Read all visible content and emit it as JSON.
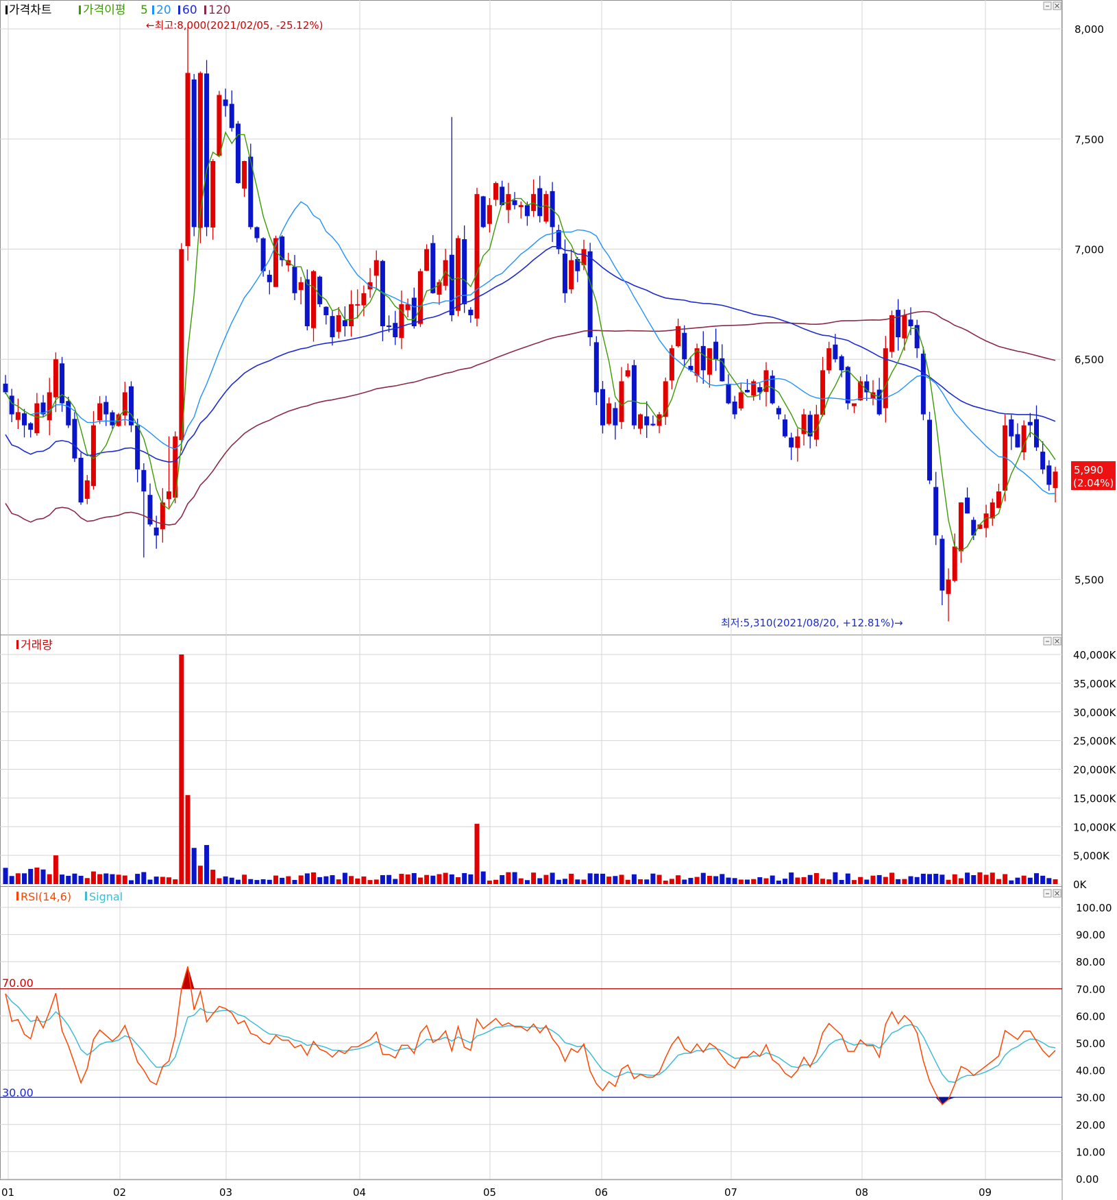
{
  "price_panel": {
    "legend": [
      {
        "text": "가격차트",
        "color": "#000000"
      },
      {
        "text": "가격이평",
        "color": "#3a9a00"
      },
      {
        "text": "5",
        "color": "#3a9a00"
      },
      {
        "text": "20",
        "color": "#1e90ff"
      },
      {
        "text": "60",
        "color": "#1c2bd0"
      },
      {
        "text": "120",
        "color": "#8b2a45"
      }
    ],
    "high_annotation": "←최고:8,000(2021/02/05, -25.12%)",
    "low_annotation": "최저:5,310(2021/08/20, +12.81%)→",
    "last_price": "5,990",
    "last_change": "(2.04%)",
    "y_ticks": [
      "8,000",
      "7,500",
      "7,000",
      "6,500",
      "6,000",
      "5,500"
    ]
  },
  "volume_panel": {
    "legend": "거래량",
    "y_ticks": [
      "40,000K",
      "35,000K",
      "30,000K",
      "25,000K",
      "20,000K",
      "15,000K",
      "10,000K",
      "5,000K",
      "0K"
    ]
  },
  "rsi_panel": {
    "legend_rsi": "RSI(14,6)",
    "legend_signal": "Signal",
    "overbought_label": "70.00",
    "oversold_label": "30.00",
    "y_ticks": [
      "100.00",
      "90.00",
      "80.00",
      "70.00",
      "60.00",
      "50.00",
      "40.00",
      "30.00",
      "20.00",
      "10.00",
      "0.00"
    ]
  },
  "x_ticks": [
    "01",
    "02",
    "03",
    "04",
    "05",
    "06",
    "07",
    "08",
    "09"
  ],
  "colors": {
    "up": "#e00000",
    "down": "#0a14c8",
    "ma5": "#3a9a00",
    "ma20": "#1e90ff",
    "ma60": "#1c2bd0",
    "ma120": "#8b2a45",
    "rsi": "#ff4500",
    "signal": "#3cbcd8",
    "grid": "#d4d4d4"
  },
  "chart_data": [
    {
      "type": "candlestick",
      "title": "가격차트",
      "x_months": [
        "01",
        "02",
        "03",
        "04",
        "05",
        "06",
        "07",
        "08",
        "09"
      ],
      "ylim": [
        5250,
        8100
      ],
      "high": {
        "value": 8000,
        "date": "2021/02/05"
      },
      "low": {
        "value": 5310,
        "date": "2021/08/20"
      },
      "last": 5990,
      "closes": [
        6350,
        6250,
        6260,
        6200,
        6180,
        6300,
        6250,
        6350,
        6500,
        6300,
        6200,
        6050,
        5850,
        5950,
        6200,
        6300,
        6250,
        6200,
        6250,
        6350,
        6200,
        6000,
        5900,
        5750,
        5700,
        5850,
        5900,
        6150,
        7000,
        7800,
        7100,
        7800,
        7100,
        7400,
        7700,
        7650,
        7550,
        7300,
        7400,
        7100,
        7050,
        6900,
        6850,
        7050,
        6950,
        6950,
        6800,
        6850,
        6650,
        6900,
        6750,
        6700,
        6600,
        6700,
        6650,
        6750,
        6750,
        6800,
        6850,
        6950,
        6650,
        6650,
        6600,
        6750,
        6750,
        6650,
        6900,
        7000,
        6800,
        6850,
        6950,
        6700,
        7050,
        6750,
        6700,
        7250,
        7100,
        7200,
        7300,
        7200,
        7250,
        7200,
        7200,
        7150,
        7250,
        7150,
        7250,
        7100,
        7000,
        6800,
        6950,
        6900,
        7000,
        6600,
        6350,
        6200,
        6300,
        6200,
        6400,
        6450,
        6200,
        6250,
        6200,
        6200,
        6250,
        6400,
        6550,
        6650,
        6500,
        6450,
        6550,
        6450,
        6550,
        6500,
        6400,
        6300,
        6250,
        6350,
        6350,
        6400,
        6350,
        6450,
        6300,
        6250,
        6150,
        6100,
        6150,
        6250,
        6150,
        6250,
        6450,
        6550,
        6500,
        6450,
        6300,
        6300,
        6400,
        6350,
        6350,
        6250,
        6550,
        6700,
        6600,
        6700,
        6650,
        6550,
        6250,
        5950,
        5700,
        5450,
        5500,
        5650,
        5850,
        5800,
        5700,
        5750,
        5800,
        5850,
        5900,
        6200,
        6150,
        6100,
        6200,
        6200,
        6100,
        6000,
        5930,
        5990
      ]
    },
    {
      "type": "bar",
      "title": "거래량",
      "unit": "K",
      "ylim": [
        0,
        40000
      ],
      "notable": [
        {
          "month": "02",
          "value": 40000
        },
        {
          "month": "02",
          "value": 15500
        },
        {
          "month": "04",
          "value": 10500
        }
      ]
    },
    {
      "type": "line",
      "title": "RSI(14,6)",
      "series": [
        {
          "name": "RSI(14,6)"
        },
        {
          "name": "Signal"
        }
      ],
      "ylim": [
        0,
        100
      ],
      "thresholds": [
        70,
        30
      ]
    }
  ]
}
